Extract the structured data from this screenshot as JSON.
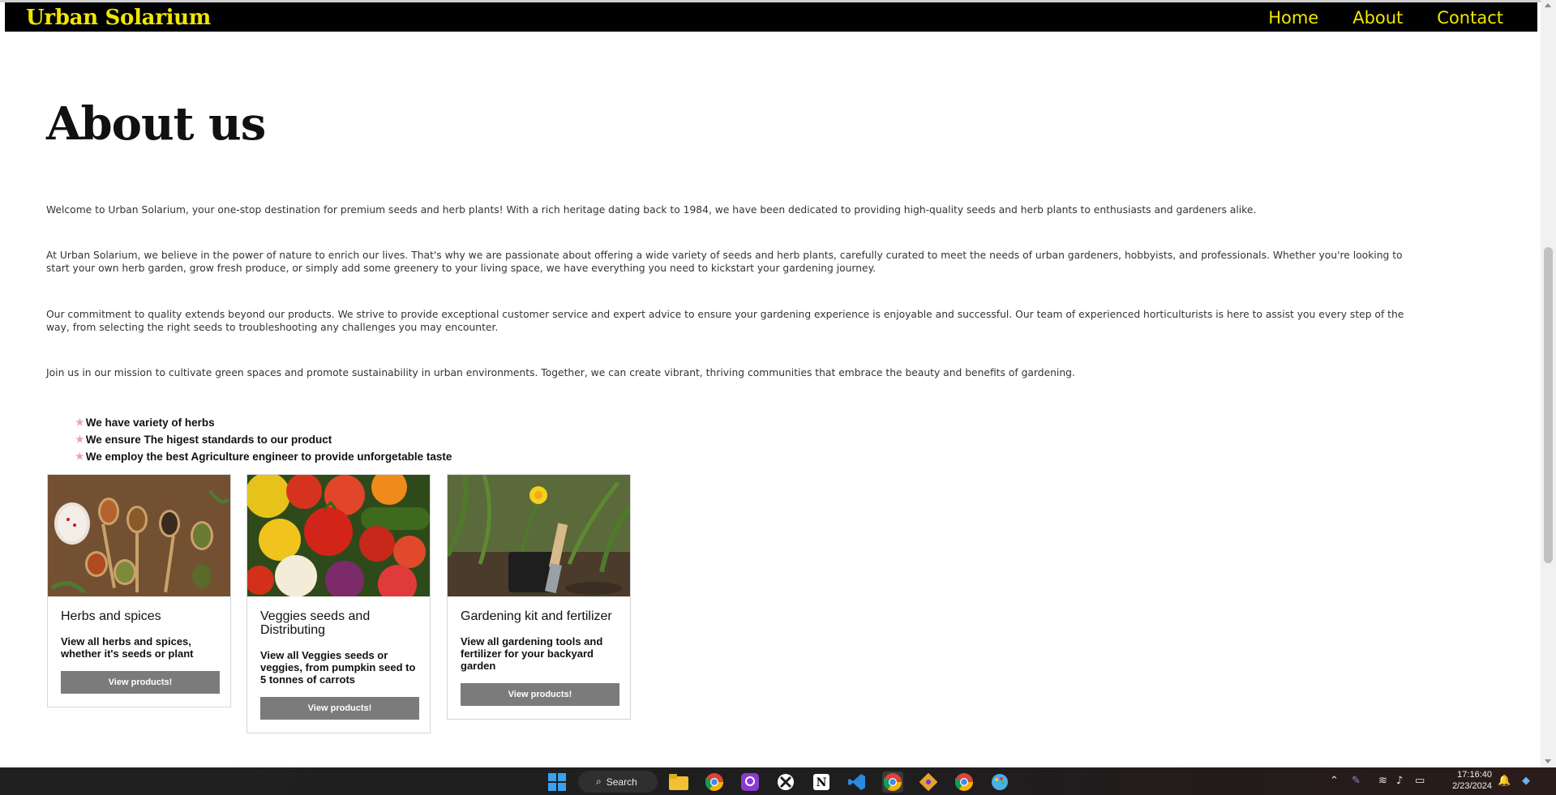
{
  "nav": {
    "brand": "Urban Solarium",
    "links": [
      "Home",
      "About",
      "Contact"
    ]
  },
  "page_title": "About us",
  "paragraphs": [
    "Welcome to Urban Solarium, your one-stop destination for premium seeds and herb plants! With a rich heritage dating back to 1984, we have been dedicated to providing high-quality seeds and herb plants to enthusiasts and gardeners alike.",
    "At Urban Solarium, we believe in the power of nature to enrich our lives. That's why we are passionate about offering a wide variety of seeds and herb plants, carefully curated to meet the needs of urban gardeners, hobbyists, and professionals. Whether you're looking to start your own herb garden, grow fresh produce, or simply add some greenery to your living space, we have everything you need to kickstart your gardening journey.",
    "Our commitment to quality extends beyond our products. We strive to provide exceptional customer service and expert advice to ensure your gardening experience is enjoyable and successful. Our team of experienced horticulturists is here to assist you every step of the way, from selecting the right seeds to troubleshooting any challenges you may encounter.",
    "Join us in our mission to cultivate green spaces and promote sustainability in urban environments. Together, we can create vibrant, thriving communities that embrace the beauty and benefits of gardening."
  ],
  "features": [
    "We have variety of herbs",
    "We ensure The higest standards to our product",
    "We employ the best Agriculture engineer to provide unforgetable taste"
  ],
  "cards": [
    {
      "title": "Herbs and spices",
      "text": "View all herbs and spices, whether it's seeds or plant",
      "button": "View products!"
    },
    {
      "title": "Veggies seeds and Distributing",
      "text": "View all Veggies seeds or veggies, from pumpkin seed to 5 tonnes of carrots",
      "button": "View products!"
    },
    {
      "title": "Gardening kit and fertilizer",
      "text": "View all gardening tools and fertilizer for your backyard garden",
      "button": "View products!"
    }
  ],
  "taskbar": {
    "search_label": "Search",
    "time": "17:16:40",
    "date": "2/23/2024"
  },
  "colors": {
    "nav_bg": "#000000",
    "brand_yellow": "#f0e600",
    "button_gray": "#7b7b7b",
    "star_pink": "#f2a0b0"
  }
}
